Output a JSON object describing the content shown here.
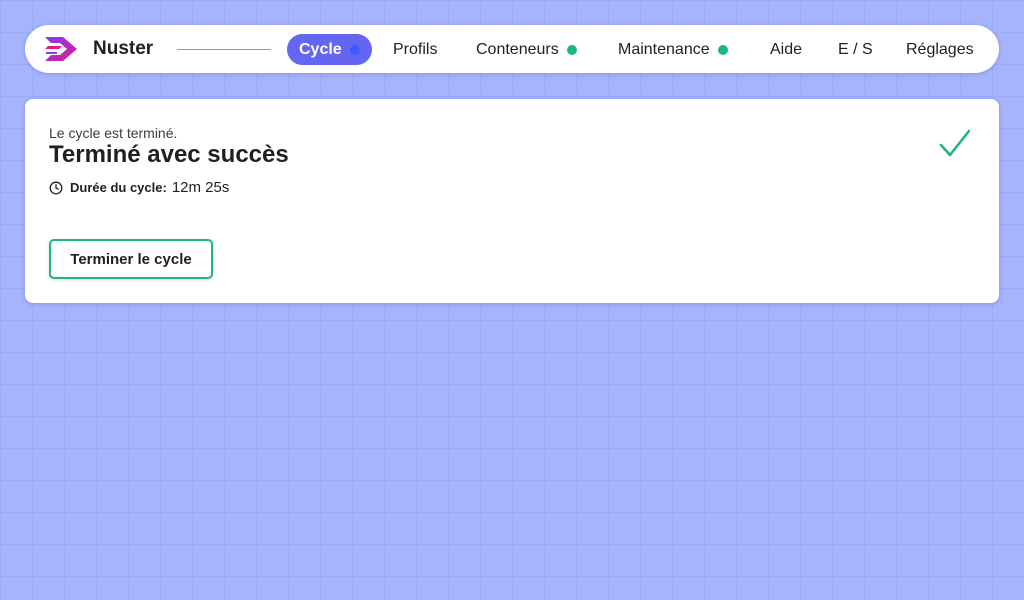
{
  "header": {
    "brand": "Nuster",
    "tabs": [
      {
        "label": "Cycle",
        "active": true,
        "status_color": "#3b5bff"
      },
      {
        "label": "Profils",
        "active": false
      },
      {
        "label": "Conteneurs",
        "active": false,
        "status_color": "#1db585"
      },
      {
        "label": "Maintenance",
        "active": false,
        "status_color": "#1db585"
      },
      {
        "label": "Aide",
        "active": false
      },
      {
        "label": "E / S",
        "active": false
      },
      {
        "label": "Réglages",
        "active": false
      }
    ]
  },
  "cycle": {
    "subtitle": "Le cycle est terminé.",
    "title": "Terminé avec succès",
    "duration_label": "Durée du cycle:",
    "duration_value": "12m 25s",
    "status_icon": "check-icon",
    "finish_button": "Terminer le cycle"
  },
  "colors": {
    "accent": "#6466f1",
    "success": "#1db585",
    "background": "#a6b3fd"
  }
}
